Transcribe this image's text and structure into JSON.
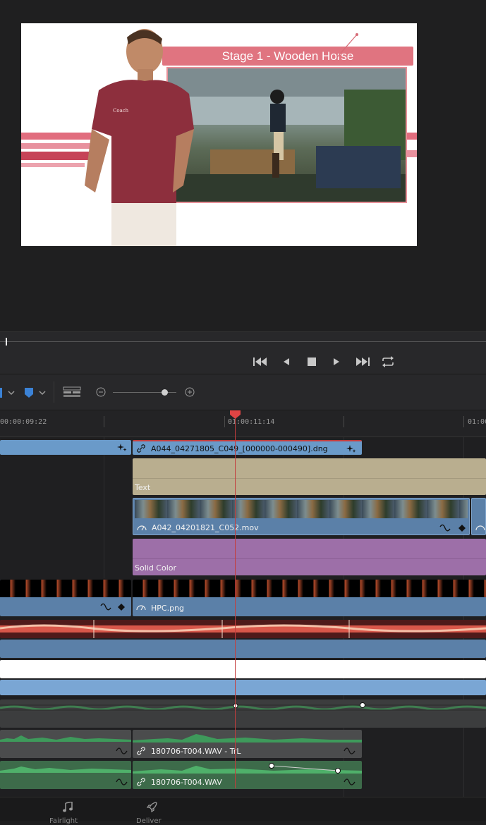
{
  "viewer": {
    "graphic_title": "Stage 1 - Wooden Horse",
    "shirt_text": "Coach"
  },
  "transport": {
    "buttons": [
      "go-to-start",
      "previous-frame",
      "stop",
      "play",
      "go-to-end",
      "loop"
    ]
  },
  "timeline": {
    "timecodes": [
      "00:00:09:22",
      "01:00:11:14",
      "01:00"
    ],
    "clips": {
      "v_top_right": "A044_04271805_C049_[000000-000490].dng",
      "text_clip": "Text",
      "video_clip": "A042_04201821_C052.mov",
      "solid_clip": "Solid Color",
      "image_clip": "HPC.png",
      "audio_a": "180706-T004.WAV - TrL",
      "audio_b": "180706-T004.WAV"
    }
  },
  "pagebar": {
    "items": [
      "Fairlight",
      "Deliver"
    ]
  },
  "colors": {
    "accent_red": "#c33d3d",
    "clip_blue": "#5e87b4",
    "text_tan": "#b9ae8f",
    "solid_purple": "#9d6fa8",
    "audio_green": "#3d6b4a"
  }
}
